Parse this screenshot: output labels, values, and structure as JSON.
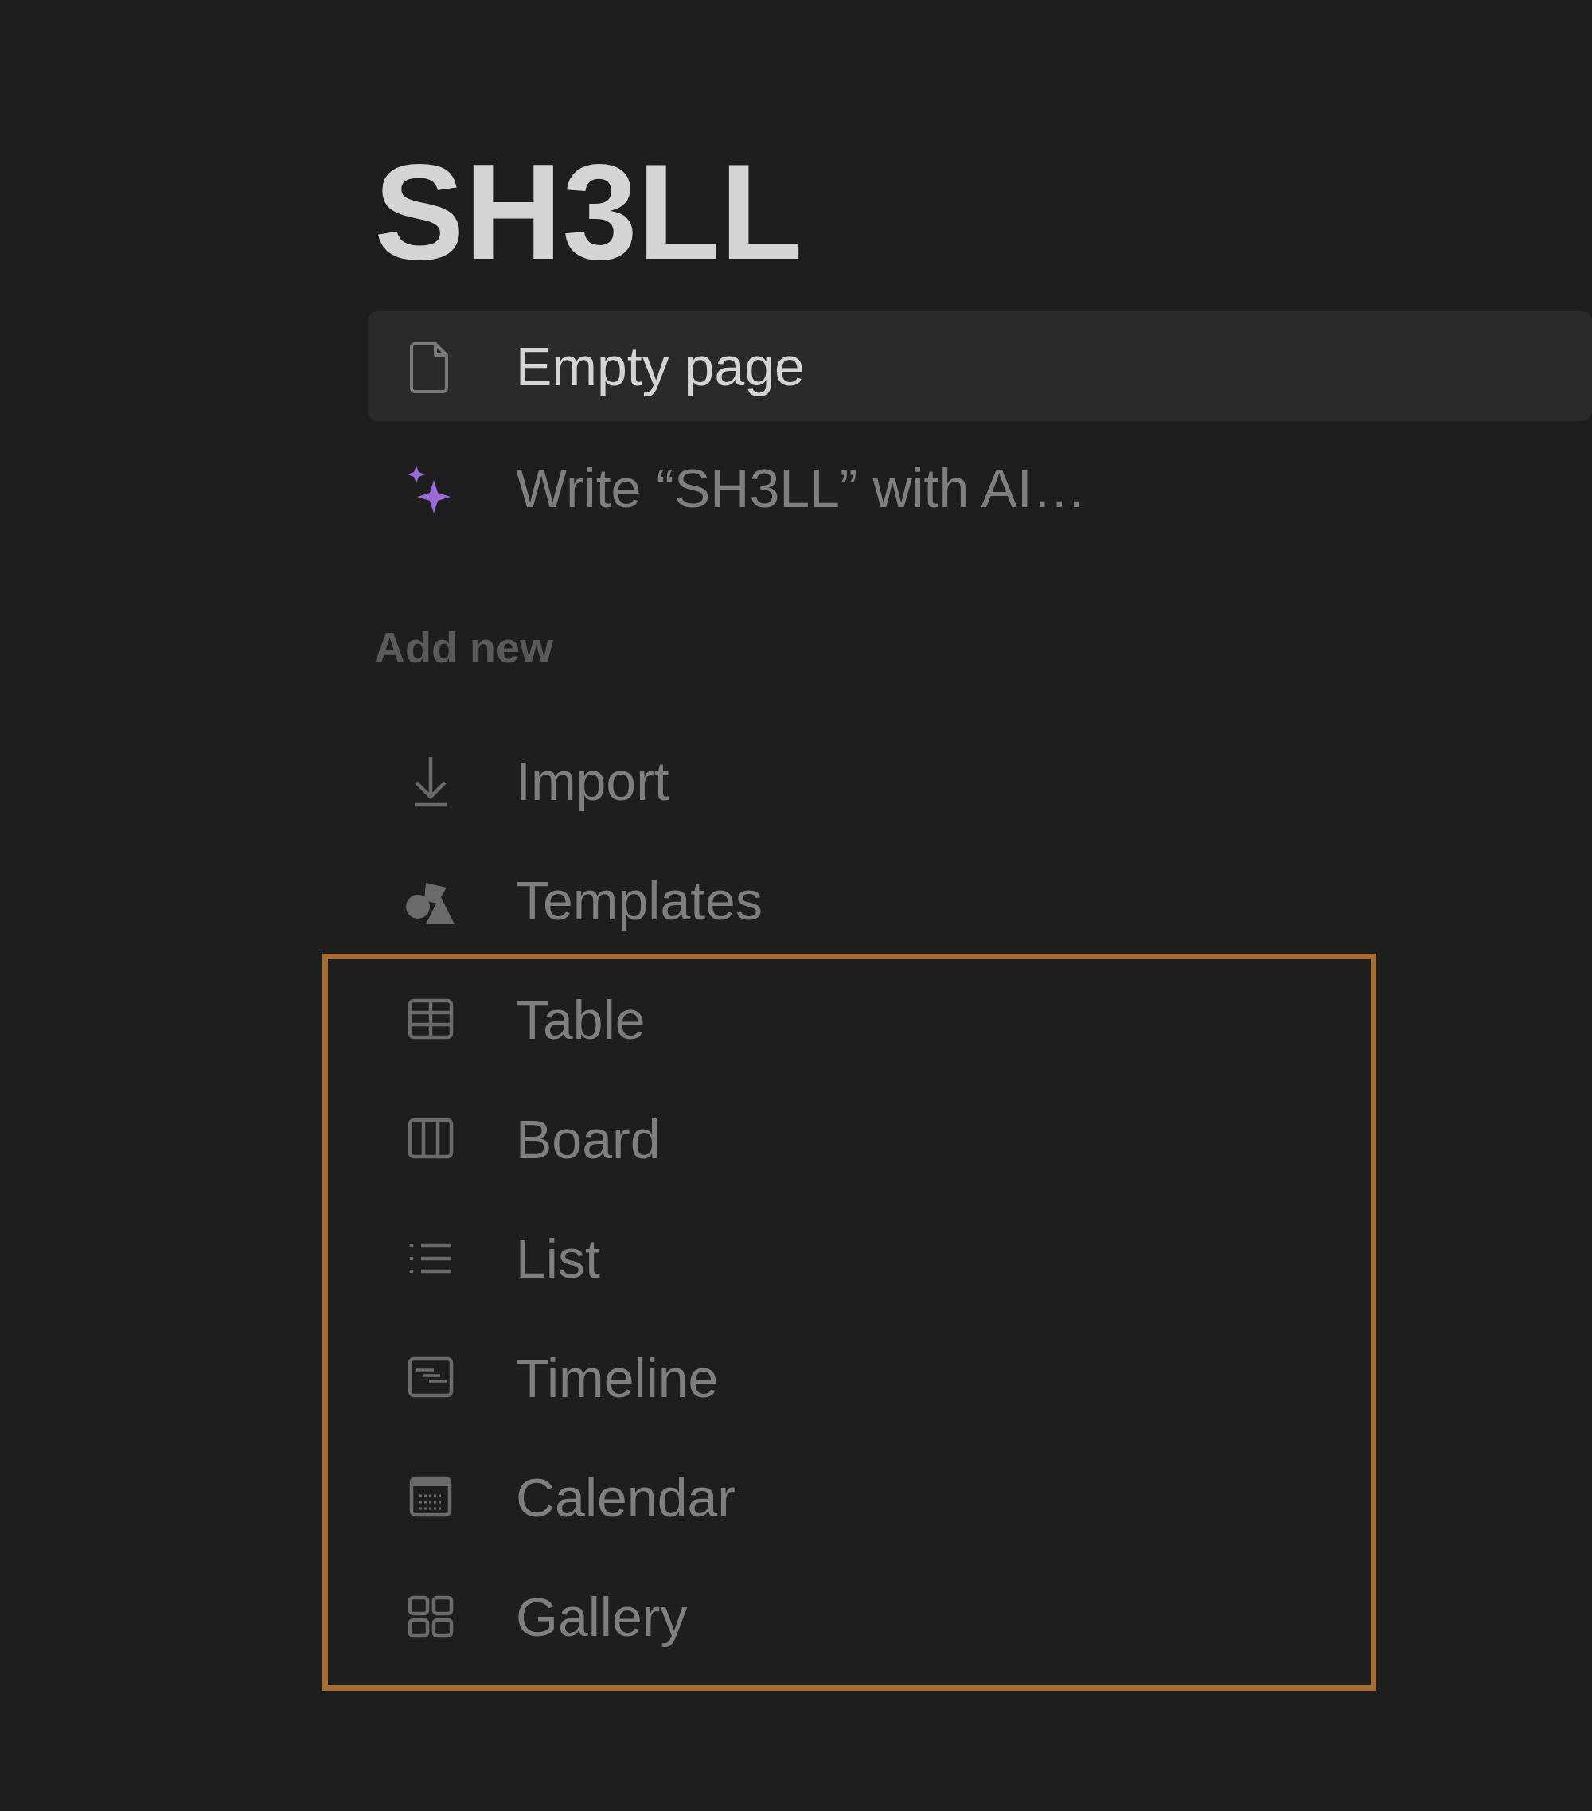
{
  "title": "SH3LL",
  "top_items": [
    {
      "kind": "page",
      "label": "Empty page",
      "selected": true
    },
    {
      "kind": "ai",
      "label": "Write “SH3LL” with AI…",
      "selected": false
    }
  ],
  "section_label": "Add new",
  "items": [
    {
      "kind": "import",
      "label": "Import",
      "highlighted": false
    },
    {
      "kind": "templates",
      "label": "Templates",
      "highlighted": false
    },
    {
      "kind": "table",
      "label": "Table",
      "highlighted": true
    },
    {
      "kind": "board",
      "label": "Board",
      "highlighted": true
    },
    {
      "kind": "list",
      "label": "List",
      "highlighted": true
    },
    {
      "kind": "timeline",
      "label": "Timeline",
      "highlighted": true
    },
    {
      "kind": "calendar",
      "label": "Calendar",
      "highlighted": true
    },
    {
      "kind": "gallery",
      "label": "Gallery",
      "highlighted": true
    }
  ]
}
